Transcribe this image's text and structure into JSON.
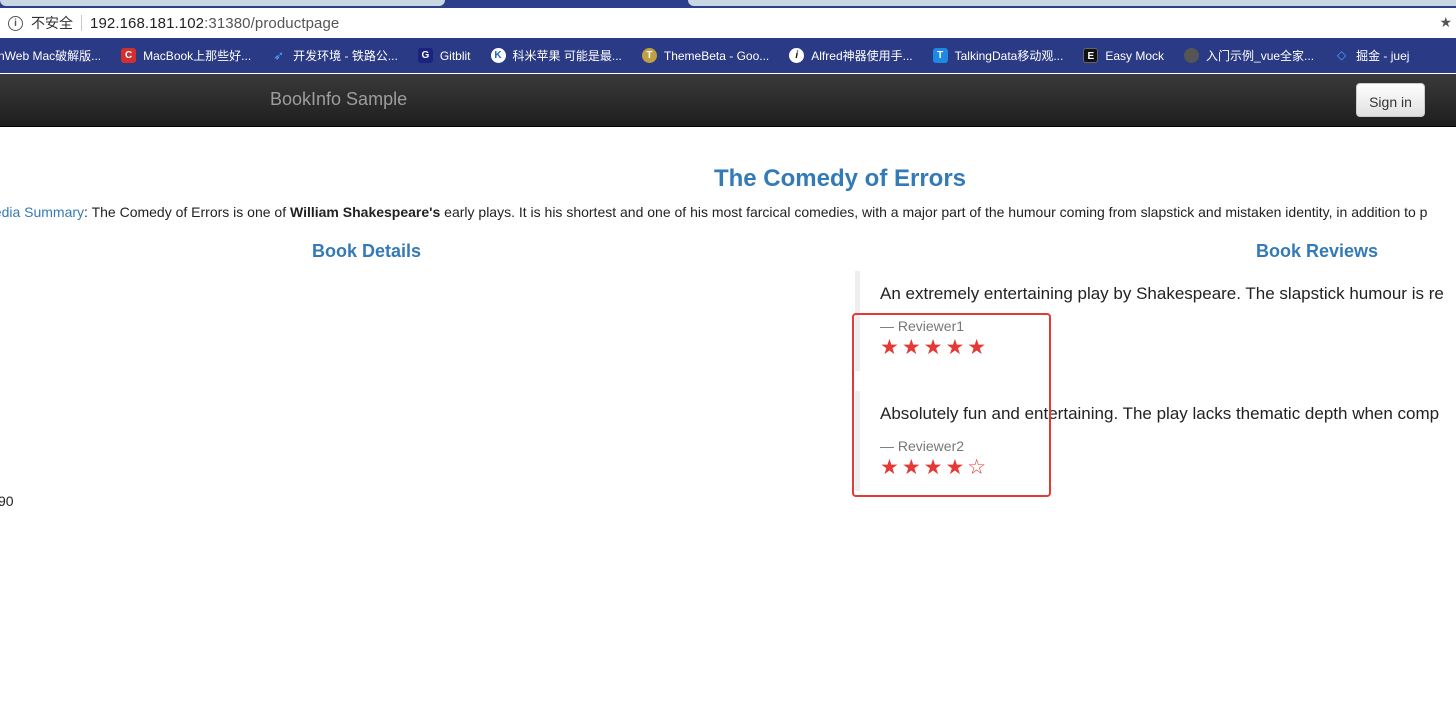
{
  "browser": {
    "security_label": "不安全",
    "url_host": "192.168.181.102",
    "url_path": ":31380/productpage",
    "bookmarks": [
      {
        "label": "nWeb Mac破解版...",
        "icon": "bookmark-icon",
        "color": "#2b3a84"
      },
      {
        "label": "MacBook上那些好...",
        "icon": "c-logo-icon",
        "color": "#d32f2f"
      },
      {
        "label": "开发环境 - 铁路公...",
        "icon": "arrow-logo-icon",
        "color": "#1e88e5"
      },
      {
        "label": "Gitblit",
        "icon": "gitblit-icon",
        "color": "#1a237e"
      },
      {
        "label": "科米苹果 可能是最...",
        "icon": "k-logo-icon",
        "color": "#1565c0"
      },
      {
        "label": "ThemeBeta - Goo...",
        "icon": "theme-icon",
        "color": "#c0a040"
      },
      {
        "label": "Alfred神器使用手...",
        "icon": "info-icon",
        "color": "#111111"
      },
      {
        "label": "TalkingData移动观...",
        "icon": "t-logo-icon",
        "color": "#1e88e5"
      },
      {
        "label": "Easy Mock",
        "icon": "easymock-icon",
        "color": "#111111"
      },
      {
        "label": "入门示例_vue全家...",
        "icon": "globe-icon",
        "color": "#555555"
      },
      {
        "label": "掘金 - juej",
        "icon": "juejin-icon",
        "color": "#1e88e5"
      }
    ]
  },
  "navbar": {
    "brand": "BookInfo Sample",
    "signin_label": "Sign in"
  },
  "main": {
    "title": "The Comedy of Errors",
    "summary_link": "pedia Summary",
    "summary_text_1": ": The Comedy of Errors is one of ",
    "summary_bold": "William Shakespeare's",
    "summary_text_2": " early plays. It is his shortest and one of his most farcical comedies, with a major part of the humour coming from slapstick and mistaken identity, in addition to p",
    "details_heading": "Book Details",
    "reviews_heading": "Book Reviews",
    "fragment": "90"
  },
  "reviews": [
    {
      "text": "An extremely entertaining play by Shakespeare. The slapstick humour is re",
      "reviewer": "— Reviewer1",
      "rating": 5,
      "max_rating": 5,
      "stars_display": "★★★★★",
      "star_color": "#e53935"
    },
    {
      "text": "Absolutely fun and entertaining. The play lacks thematic depth when comp",
      "reviewer": "— Reviewer2",
      "rating": 4,
      "max_rating": 5,
      "stars_display": "★★★★☆",
      "star_color": "#e53935"
    }
  ],
  "colors": {
    "accent": "#337ab7",
    "highlight": "#e53935",
    "navbar": "#222222",
    "bookmark_bar": "#2b3a84"
  }
}
